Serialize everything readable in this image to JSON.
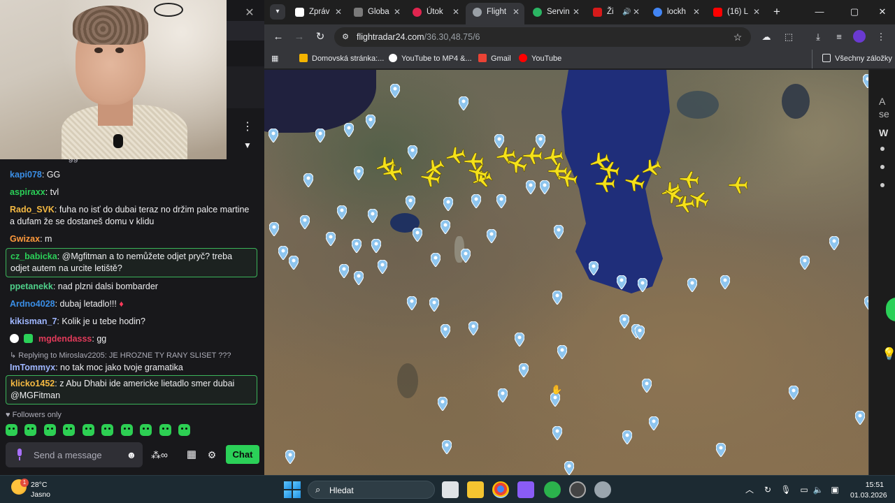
{
  "chat": {
    "top_partial": "· gg",
    "messages": [
      {
        "user": "kapi078",
        "text": ": GG",
        "color": "#3a8ee6"
      },
      {
        "user": "aspiraxx",
        "text": ": tvl",
        "color": "#2bd058"
      },
      {
        "user": "Rado_SVK",
        "text": ": fuha no isť do dubai teraz no držim palce martine a dufam že se dostaneš domu v klidu",
        "color": "#f5b942"
      },
      {
        "user": "Gwizax",
        "text": ": m",
        "color": "#ff9a3c"
      },
      {
        "user": "cz_babicka",
        "text": ": @Mgfitman a to nemůžete odjet pryč? treba odjet autem na urcite letiště?",
        "color": "#2bd058",
        "highlight": true
      },
      {
        "user": "ppetanekk",
        "text": ": nad plzni dalsi bombarder",
        "color": "#4fd08a"
      },
      {
        "user": "Ardno4028",
        "text": ": dubaj letadlo!!!",
        "color": "#3a8ee6"
      },
      {
        "user": "kikisman_7",
        "text": ": Kolik je u tebe hodin?",
        "color": "#9fb6ff"
      },
      {
        "user": "mgdendasss",
        "text": ": gg",
        "color": "#e23a5a"
      },
      {
        "reply_to": "Replying to Miroslav2205: JE HROZNE TY RANY SLISET ???",
        "user": "ImTommyx",
        "text": ": no tak moc jako tvoje gramatika",
        "color": "#9fb6ff"
      },
      {
        "user": "klicko1452",
        "text": ": z Abu Dhabi ide americke lietadlo smer dubai @MGFitman",
        "color": "#f5b942",
        "highlight": true
      }
    ],
    "followers_only": "Followers only",
    "send_placeholder": "Send a message",
    "chat_button": "Chat"
  },
  "browser": {
    "tabs": [
      {
        "label": "Zpráv",
        "favicon_color": "#ffffff"
      },
      {
        "label": "Globa",
        "favicon_color": "#7a7a7a"
      },
      {
        "label": "Útok",
        "favicon_color": "#e0254f"
      },
      {
        "label": "Flight",
        "favicon_color": "#9aa0a6",
        "active": true
      },
      {
        "label": "Servin",
        "favicon_color": "#2bb563"
      },
      {
        "label": "Ži",
        "favicon_color": "#d61a1a"
      },
      {
        "label": "lockh",
        "favicon_color": "#4285f4"
      },
      {
        "label": "(16) L",
        "favicon_color": "#ff0000"
      }
    ],
    "url_host": "flightradar24.com",
    "url_path": "/36.30,48.75/6",
    "bookmarks": [
      {
        "label": "Domovská stránka:...",
        "color": "#f4b400"
      },
      {
        "label": "YouTube to MP4 &...",
        "color": "#ffffff"
      },
      {
        "label": "Gmail",
        "color": "#ea4335"
      },
      {
        "label": "YouTube",
        "color": "#ff0000"
      }
    ],
    "all_bookmarks": "Všechny záložky"
  },
  "map": {
    "plane_color": "#f5e11a",
    "pin_color": "#8ec5ee",
    "side_text": "A\nse",
    "side_letter": "W"
  },
  "taskbar": {
    "temperature": "28°C",
    "condition": "Jasno",
    "weather_badge": "1",
    "search_label": "Hledat",
    "time": "15:51",
    "date": "01.03.2026"
  }
}
